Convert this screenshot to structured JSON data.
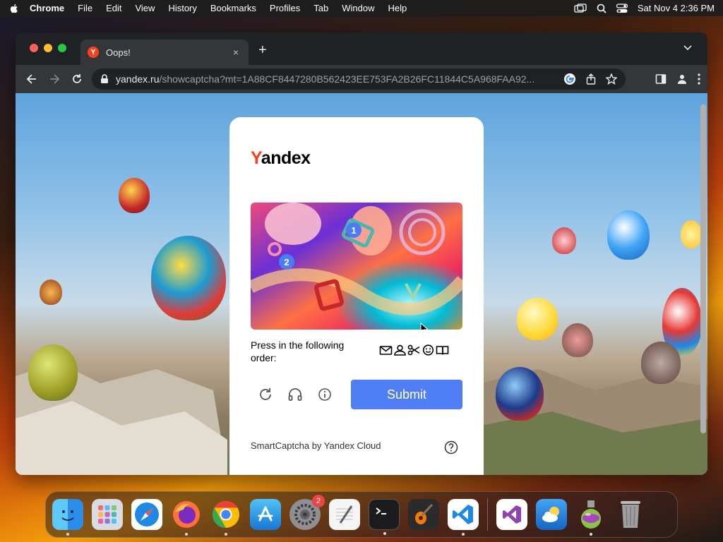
{
  "menubar": {
    "app": "Chrome",
    "items": [
      "File",
      "Edit",
      "View",
      "History",
      "Bookmarks",
      "Profiles",
      "Tab",
      "Window",
      "Help"
    ],
    "clock": "Sat Nov 4  2:36 PM"
  },
  "browser": {
    "tab_title": "Oops!",
    "tab_close": "×",
    "new_tab": "+",
    "url_host": "yandex.ru",
    "url_path": "/showcaptcha?mt=1A88CF8447280B562423EE753FA2B26FC11844C5A968FAA92..."
  },
  "captcha": {
    "logo_y": "Y",
    "logo_rest": "andex",
    "badge_1": "1",
    "badge_2": "2",
    "instruction": "Press in the following order:",
    "order_icons": [
      "envelope-icon",
      "person-icon",
      "scissors-icon",
      "smiley-icon",
      "book-icon"
    ],
    "submit_label": "Submit",
    "footer": "SmartCaptcha by Yandex Cloud"
  },
  "dock": {
    "apps": [
      "Finder",
      "Launchpad",
      "Safari",
      "Firefox",
      "Chrome",
      "App Store",
      "System Settings",
      "TextEdit",
      "Terminal",
      "GarageBand",
      "VS Code",
      "Visual Studio",
      "Weather",
      "Automator",
      "Trash"
    ],
    "settings_badge": "2"
  },
  "colors": {
    "yandex_red": "#fc3f1d",
    "submit_blue": "#4f7ef5",
    "badge_blue": "#4a7cf5"
  }
}
